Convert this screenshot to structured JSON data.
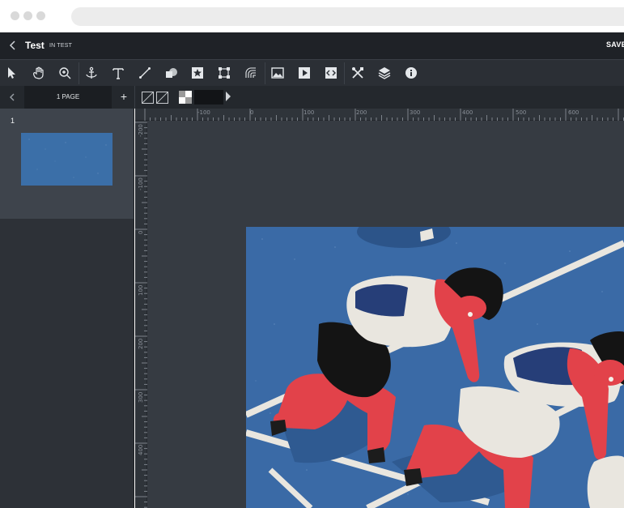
{
  "app": {
    "title": "Test",
    "status": "IN TEST",
    "save_label": "SAVE"
  },
  "toolbar": {
    "tools": [
      {
        "name": "select",
        "icon": "pointer-icon"
      },
      {
        "name": "pan",
        "icon": "hand-icon"
      },
      {
        "name": "zoom",
        "icon": "zoom-in-icon"
      },
      {
        "name": "anchor",
        "icon": "anchor-icon"
      },
      {
        "name": "text",
        "icon": "text-icon"
      },
      {
        "name": "line",
        "icon": "line-icon"
      },
      {
        "name": "shapes",
        "icon": "shapes-icon"
      },
      {
        "name": "star",
        "icon": "star-icon"
      },
      {
        "name": "transform",
        "icon": "transform-icon"
      },
      {
        "name": "gradient-line",
        "icon": "gradient-icon"
      },
      {
        "name": "image",
        "icon": "image-icon"
      },
      {
        "name": "video",
        "icon": "play-icon"
      },
      {
        "name": "embed",
        "icon": "code-icon"
      },
      {
        "name": "tools",
        "icon": "tools-icon"
      },
      {
        "name": "layers",
        "icon": "layers-icon"
      },
      {
        "name": "info",
        "icon": "info-icon"
      }
    ]
  },
  "pages": {
    "tab_label": "1 PAGE",
    "items": [
      {
        "number": "1"
      }
    ]
  },
  "ruler": {
    "top_labels": [
      "-100",
      "0",
      "100",
      "200",
      "300",
      "400",
      "500",
      "600"
    ],
    "left_labels": [
      "-200",
      "-100",
      "0",
      "100",
      "200",
      "300",
      "400"
    ]
  },
  "colors": {
    "app_bg": "#363b42",
    "toolbar_bg": "#2b2f35",
    "titlebar_bg": "#1f2227",
    "artwork_blue": "#3a6aa6",
    "artwork_red": "#e2424a"
  }
}
